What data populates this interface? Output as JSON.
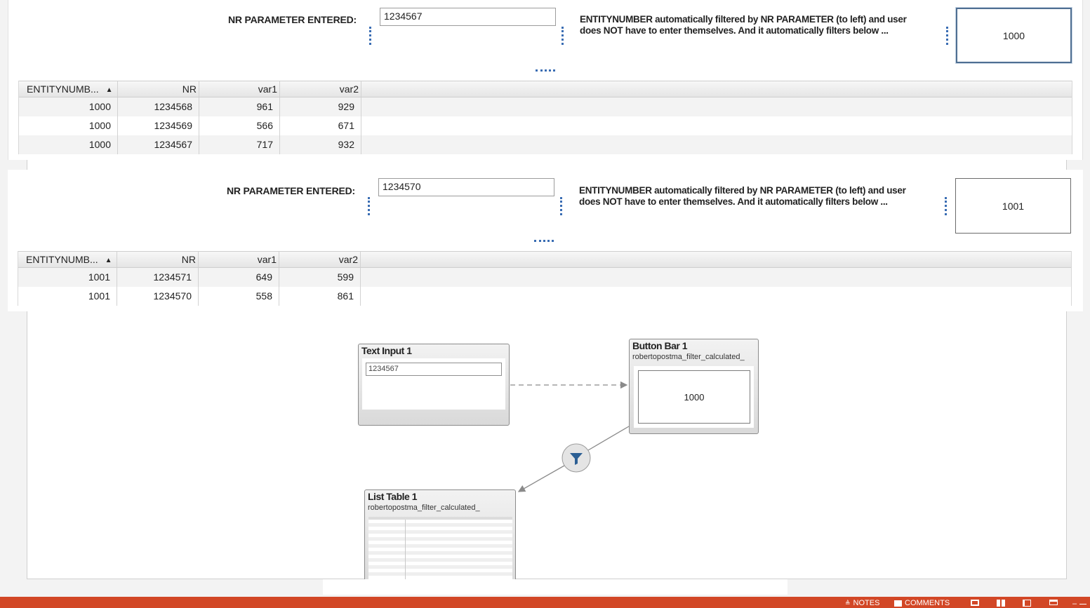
{
  "panel1": {
    "param_label": "NR PARAMETER ENTERED:",
    "param_value": "1234567",
    "description_line1": "ENTITYNUMBER automatically filtered by NR PARAMETER (to left) and user",
    "description_line2": "does NOT have to enter themselves.  And it automatically filters below ...",
    "button_value": "1000",
    "table": {
      "headers": [
        "ENTITYNUMB...",
        "NR",
        "var1",
        "var2"
      ],
      "rows": [
        [
          "1000",
          "1234568",
          "961",
          "929"
        ],
        [
          "1000",
          "1234569",
          "566",
          "671"
        ],
        [
          "1000",
          "1234567",
          "717",
          "932"
        ]
      ]
    }
  },
  "panel2": {
    "param_label": "NR PARAMETER ENTERED:",
    "param_value": "1234570",
    "description_line1": "ENTITYNUMBER automatically filtered by NR PARAMETER (to left) and user",
    "description_line2": "does NOT have to enter themselves.  And it automatically filters below ...",
    "button_value": "1001",
    "table": {
      "headers": [
        "ENTITYNUMB...",
        "NR",
        "var1",
        "var2"
      ],
      "rows": [
        [
          "1001",
          "1234571",
          "649",
          "599"
        ],
        [
          "1001",
          "1234570",
          "558",
          "861"
        ]
      ]
    }
  },
  "diagram": {
    "text_input": {
      "title": "Text Input 1",
      "value": "1234567"
    },
    "button_bar": {
      "title": "Button Bar 1",
      "subtitle": "robertopostma_filter_calculated_",
      "value": "1000"
    },
    "list_table": {
      "title": "List Table 1",
      "subtitle": "robertopostma_filter_calculated_"
    }
  },
  "statusbar": {
    "notes_label": "NOTES",
    "comments_label": "COMMENTS",
    "accent_color": "#d24726"
  }
}
